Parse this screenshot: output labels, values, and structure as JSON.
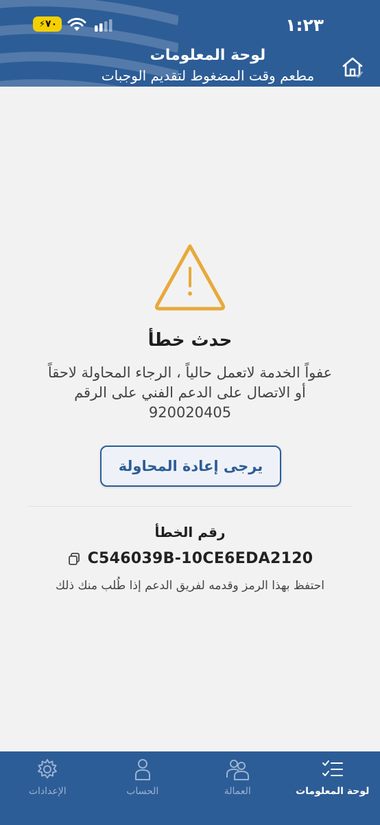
{
  "status_bar": {
    "time": "١:٢٣",
    "battery": "٧٠"
  },
  "header": {
    "title": "لوحة المعلومات",
    "subtitle": "مطعم وقت المضغوط لتقديم الوجبات"
  },
  "error": {
    "title": "حدث خطأ",
    "message_line1": "عفواً الخدمة لاتعمل حالياً ، الرجاء المحاولة لاحقاً",
    "message_line2": "أو الاتصال على الدعم الفني على الرقم",
    "phone": "920020405",
    "retry_label": "يرجى إعادة المحاولة",
    "code_label": "رقم الخطأ",
    "code_value": "C546039B-10CE6EDA2120",
    "code_hint": "احتفظ بهذا الرمز وقدمه لفريق الدعم إذا طُلب منك ذلك"
  },
  "nav": {
    "items": [
      {
        "label": "الإعدادات",
        "icon": "gear-icon",
        "active": false
      },
      {
        "label": "الحساب",
        "icon": "person-icon",
        "active": false
      },
      {
        "label": "العمالة",
        "icon": "group-icon",
        "active": false
      },
      {
        "label": "لوحة المعلومات",
        "icon": "checklist-icon",
        "active": true
      }
    ]
  },
  "colors": {
    "brand": "#2d5d96",
    "warning": "#e8a93a",
    "background": "#f2f2f2"
  }
}
